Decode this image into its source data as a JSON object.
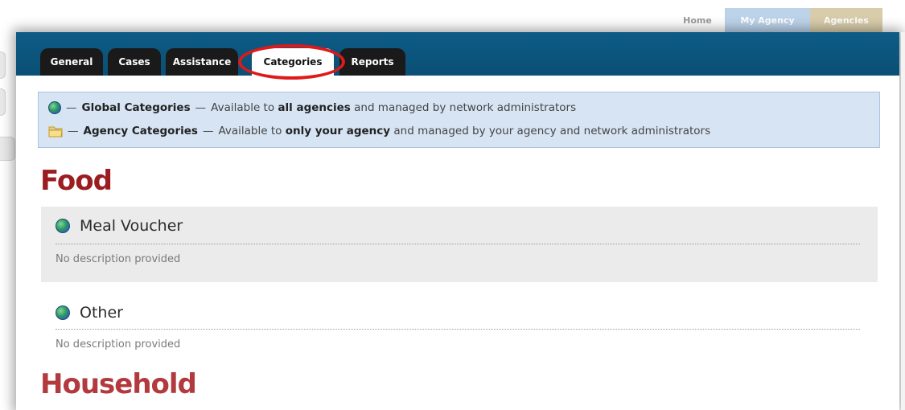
{
  "top_nav": {
    "home": "Home",
    "my_agency": "My Agency",
    "agencies": "Agencies"
  },
  "tabs": [
    {
      "label": "General",
      "active": false
    },
    {
      "label": "Cases",
      "active": false
    },
    {
      "label": "Assistance",
      "active": false
    },
    {
      "label": "Categories",
      "active": true
    },
    {
      "label": "Reports",
      "active": false
    }
  ],
  "legend": {
    "global": {
      "name": "Global Categories",
      "dash": "—",
      "text_pre": "Available to ",
      "emphasis": "all agencies",
      "text_post": " and managed by network administrators"
    },
    "agency": {
      "name": "Agency Categories",
      "dash": "—",
      "text_pre": "Available to ",
      "emphasis": "only your agency",
      "text_post": " and managed by your agency and network administrators"
    }
  },
  "categories": [
    {
      "title": "Food",
      "items": [
        {
          "name": "Meal Voucher",
          "description": "No description provided",
          "icon": "globe-icon"
        },
        {
          "name": "Other",
          "description": "No description provided",
          "icon": "globe-icon"
        }
      ]
    },
    {
      "title": "Household",
      "items": []
    }
  ],
  "colors": {
    "header_blue": "#0d5c87",
    "category_title": "#9b1d21",
    "legend_bg": "#d7e4f3",
    "highlight": "#e01818"
  }
}
